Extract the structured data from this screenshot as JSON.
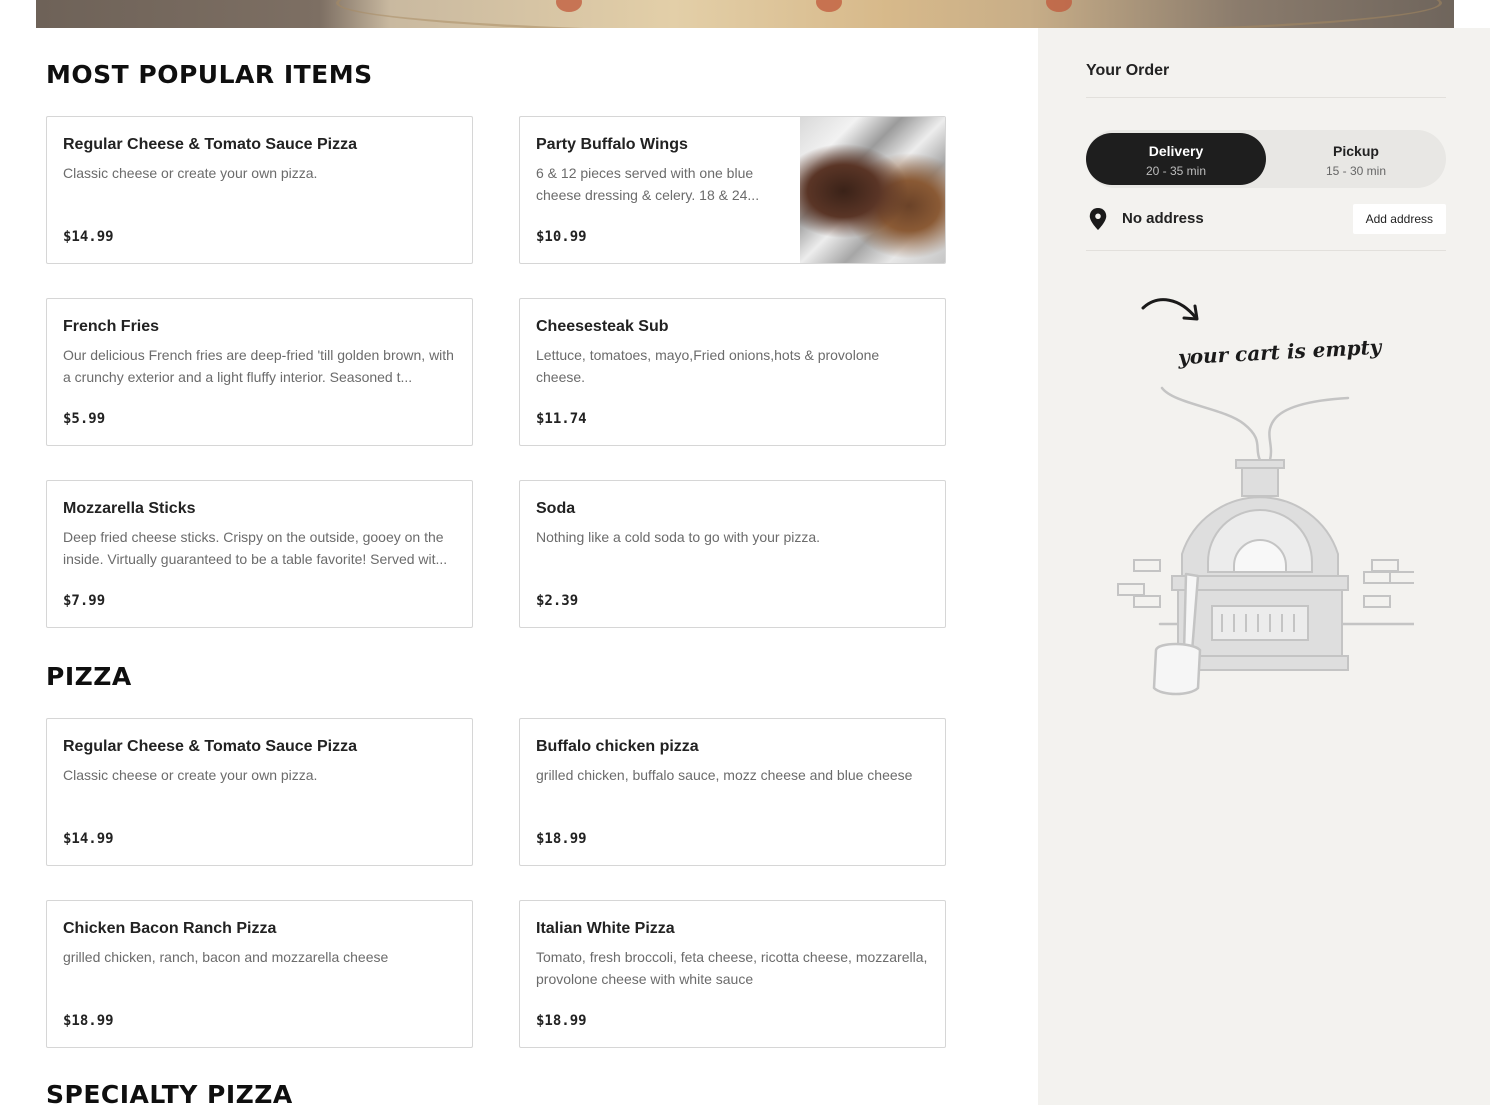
{
  "sections": {
    "popular_title": "MOST POPULAR ITEMS",
    "pizza_title": "PIZZA",
    "specialty_title": "SPECIALTY PIZZA"
  },
  "popular": [
    {
      "name": "Regular Cheese & Tomato Sauce Pizza",
      "desc": "Classic cheese or create your own pizza.",
      "price": "$14.99"
    },
    {
      "name": "Party Buffalo Wings",
      "desc": "6 & 12 pieces served with one blue cheese dressing & celery. 18 & 24...",
      "price": "$10.99",
      "image": "buffalo-wings-photo"
    },
    {
      "name": "French Fries",
      "desc": "Our delicious French fries are deep-fried 'till golden brown, with a crunchy exterior and a light fluffy interior. Seasoned t...",
      "price": "$5.99"
    },
    {
      "name": "Cheesesteak Sub",
      "desc": "Lettuce, tomatoes, mayo,Fried onions,hots & provolone cheese.",
      "price": "$11.74"
    },
    {
      "name": "Mozzarella Sticks",
      "desc": "Deep fried cheese sticks. Crispy on the outside, gooey on the inside. Virtually guaranteed to be a table favorite! Served wit...",
      "price": "$7.99"
    },
    {
      "name": "Soda",
      "desc": "Nothing like a cold soda to go with your pizza.",
      "price": "$2.39"
    }
  ],
  "pizza": [
    {
      "name": "Regular Cheese & Tomato Sauce Pizza",
      "desc": "Classic cheese or create your own pizza.",
      "price": "$14.99"
    },
    {
      "name": "Buffalo chicken pizza",
      "desc": "grilled chicken, buffalo sauce, mozz cheese and blue cheese",
      "price": "$18.99"
    },
    {
      "name": "Chicken Bacon Ranch Pizza",
      "desc": "grilled chicken, ranch, bacon and mozzarella cheese",
      "price": "$18.99"
    },
    {
      "name": "Italian White Pizza",
      "desc": "Tomato, fresh broccoli, feta cheese, ricotta cheese, mozzarella, provolone cheese with white sauce",
      "price": "$18.99"
    }
  ],
  "order": {
    "title": "Your Order",
    "delivery": {
      "label": "Delivery",
      "time": "20 - 35 min",
      "selected": true
    },
    "pickup": {
      "label": "Pickup",
      "time": "15 - 30 min",
      "selected": false
    },
    "address": "No address",
    "add_address_label": "Add address",
    "empty_message": "your cart is empty"
  },
  "icons": {
    "address": "location-pin-icon",
    "empty_arrow": "curved-arrow-icon",
    "empty_illustration": "pizza-oven-illustration"
  },
  "colors": {
    "toggle_active": "#1e1e1e",
    "sidebar_bg": "#f3f2ef",
    "card_border": "#d6d6d6"
  }
}
